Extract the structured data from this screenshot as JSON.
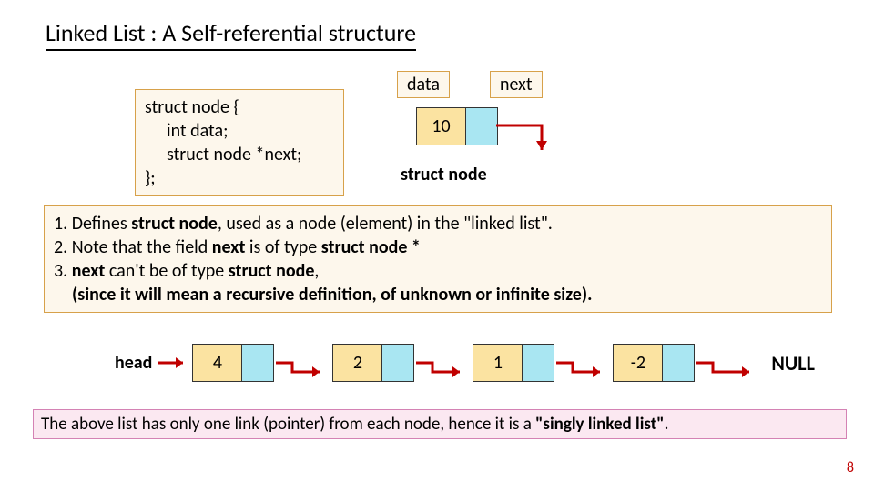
{
  "title": "Linked List : A Self-referential structure",
  "code": {
    "l1": "struct node {",
    "l2": "int data;",
    "l3": "struct node *next;",
    "l4": "};"
  },
  "labels": {
    "data": "data",
    "next": "next",
    "struct_caption": "struct node",
    "head": "head",
    "null": "NULL"
  },
  "single_node_value": "10",
  "notes": {
    "p1a": "1.   Defines ",
    "p1b": "struct node",
    "p1c": ", used as a node (element) in the \"linked list\".",
    "p2a": "2.   Note that the field ",
    "p2b": "next",
    "p2c": " is of type ",
    "p2d": "struct node *",
    "p3a": "3.   ",
    "p3b": "next",
    "p3c": " can't be of type ",
    "p3d": "struct node",
    "p3e": ",",
    "p4": "(since it will mean a recursive definition, of unknown or infinite size)."
  },
  "list_values": [
    "4",
    "2",
    "1",
    "-2"
  ],
  "footnote": {
    "a": "The above list has only one link (pointer) from each node, hence it is a ",
    "b": "\"singly linked list\"",
    "c": "."
  },
  "slide_number": "8"
}
